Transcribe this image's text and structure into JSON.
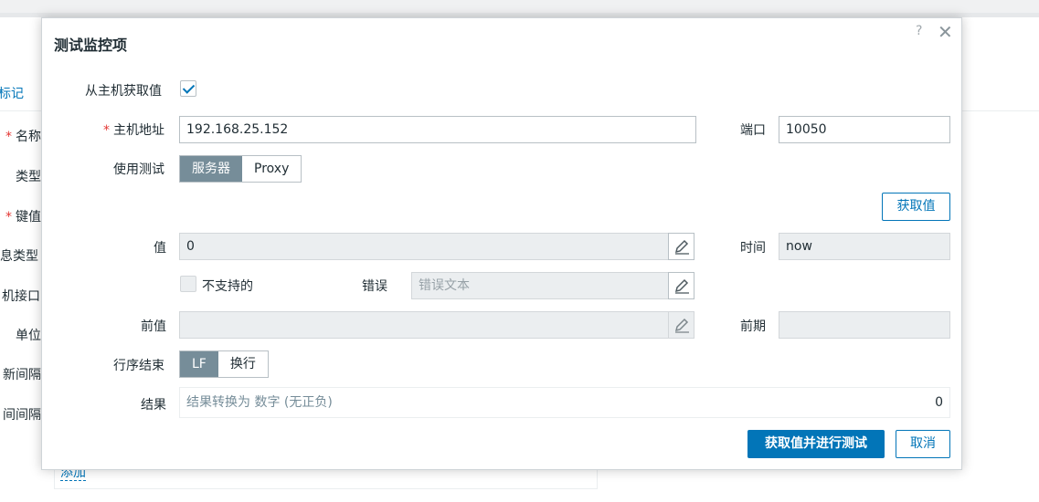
{
  "background": {
    "tab_label": "标记",
    "labels": [
      {
        "req": "*",
        "text": "名称"
      },
      {
        "req": "",
        "text": "类型"
      },
      {
        "req": "*",
        "text": "键值"
      },
      {
        "req": "",
        "text": "息类型"
      },
      {
        "req": "",
        "text": "机接口"
      },
      {
        "req": "",
        "text": "单位"
      },
      {
        "req": "",
        "text": "新间隔"
      },
      {
        "req": "",
        "text": "间间隔"
      }
    ],
    "add_link": "添加"
  },
  "dialog": {
    "title": "测试监控项",
    "help_icon": "?",
    "close_icon": "✕",
    "get_from_host": {
      "label": "从主机获取值",
      "checked": true
    },
    "host_address": {
      "required_mark": "*",
      "label": "主机地址",
      "value": "192.168.25.152"
    },
    "port": {
      "label": "端口",
      "value": "10050"
    },
    "test_with": {
      "label": "使用测试",
      "options": [
        "服务器",
        "Proxy"
      ],
      "selected": "服务器"
    },
    "get_value_button": "获取值",
    "value": {
      "label": "值",
      "value": "0"
    },
    "time": {
      "label": "时间",
      "value": "now"
    },
    "not_supported": {
      "label": "不支持的",
      "checked": false
    },
    "error": {
      "label": "错误",
      "placeholder": "错误文本"
    },
    "prev_value": {
      "label": "前值",
      "value": ""
    },
    "prev_time": {
      "label": "前期",
      "value": ""
    },
    "eol": {
      "label": "行序结束",
      "options": [
        "LF",
        "换行"
      ],
      "selected": "LF"
    },
    "result": {
      "label": "结果",
      "text": "结果转换为 数字 (无正负)",
      "value": "0"
    },
    "test_button": "获取值并进行测试",
    "cancel_button": "取消"
  },
  "colors": {
    "accent": "#0275b8",
    "required": "#e33734",
    "segment_active": "#768d99"
  }
}
